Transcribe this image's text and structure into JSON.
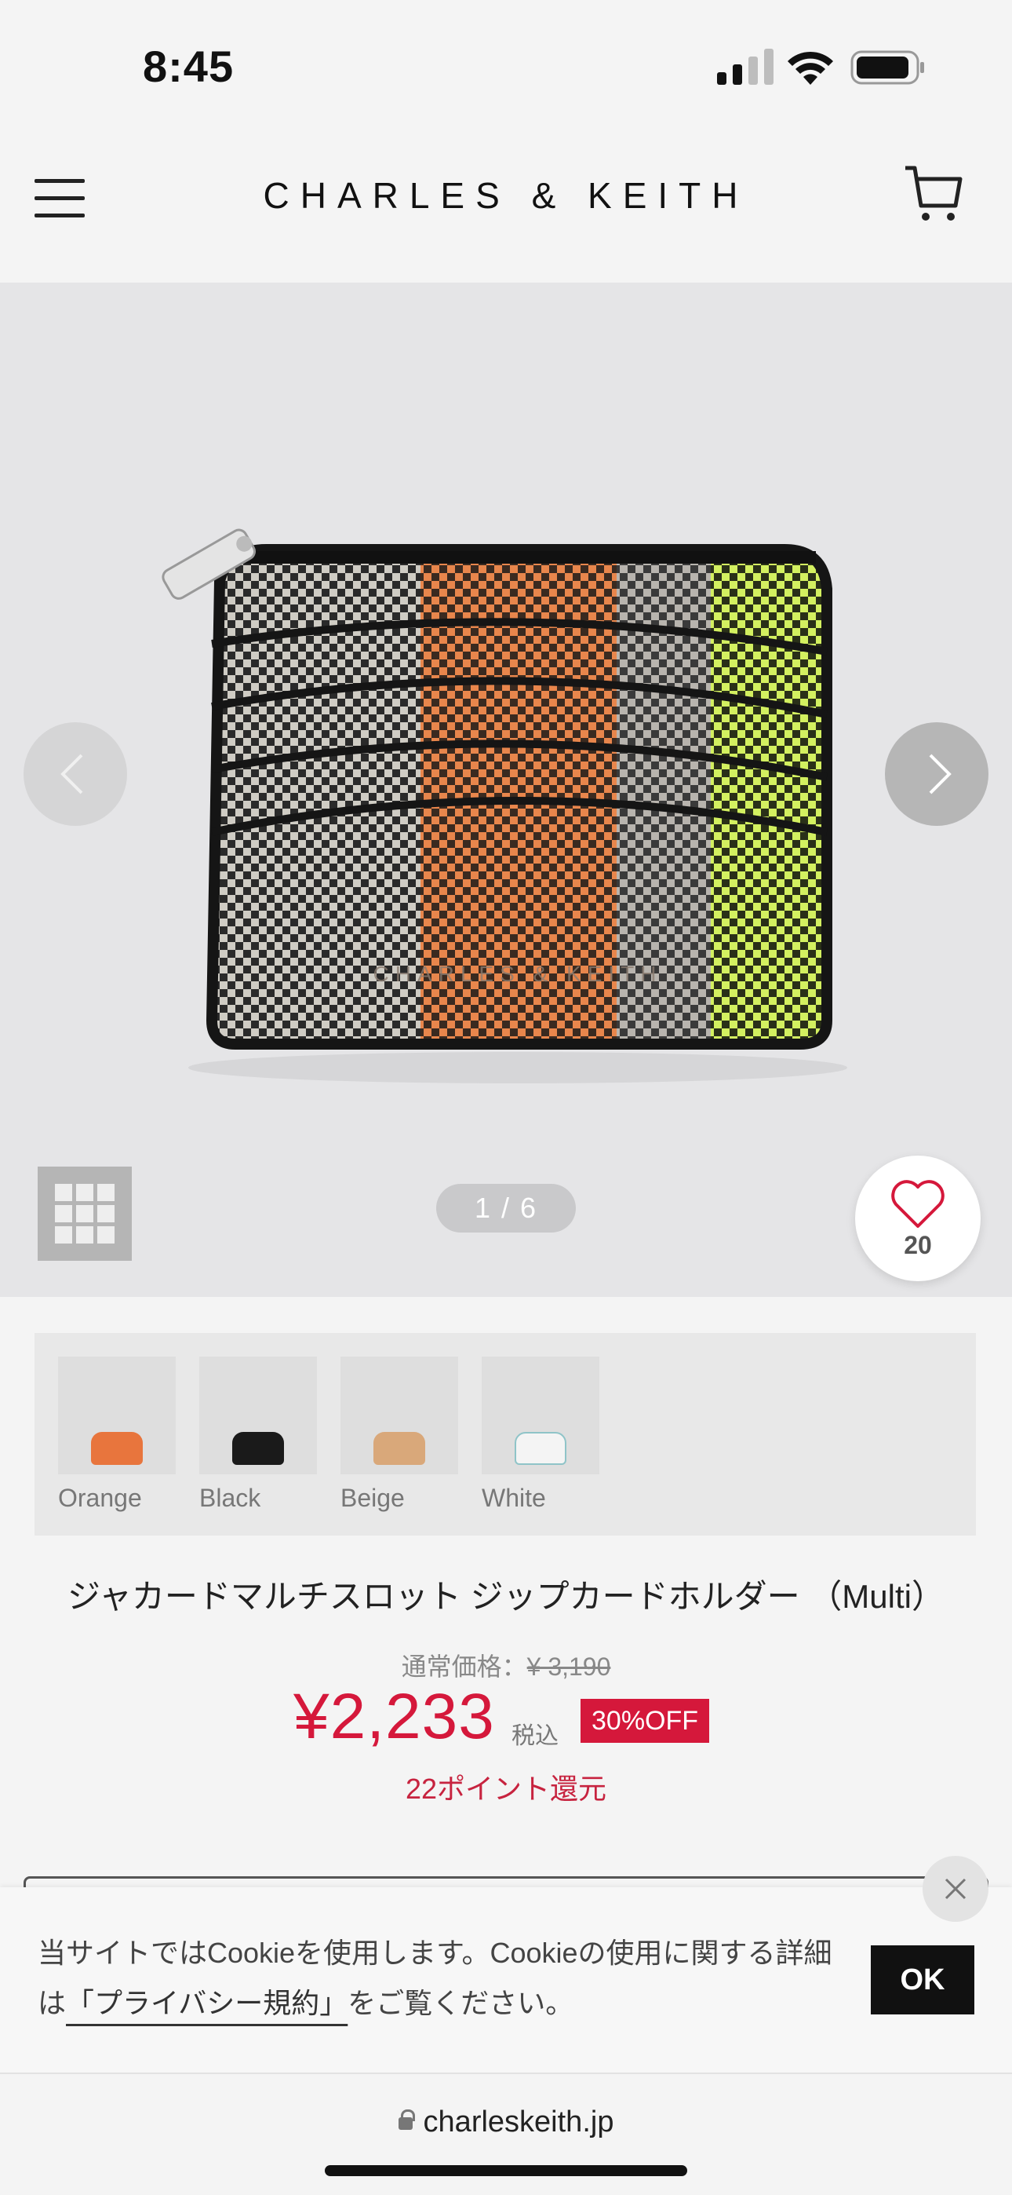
{
  "status_bar": {
    "time": "8:45"
  },
  "header": {
    "brand": "CHARLES & KEITH",
    "menu_icon": "hamburger-menu-icon",
    "cart_icon": "shopping-cart-icon"
  },
  "gallery": {
    "pager": "1 / 6",
    "like_count": "20",
    "prev_icon": "chevron-left-icon",
    "next_icon": "chevron-right-icon",
    "grid_icon": "grid-icon",
    "like_icon": "heart-icon"
  },
  "swatches": [
    {
      "label": "Orange",
      "color": "#e8753d"
    },
    {
      "label": "Black",
      "color": "#1a1a1a"
    },
    {
      "label": "Beige",
      "color": "#d9a87a"
    },
    {
      "label": "White",
      "color": "#f2f2f2"
    }
  ],
  "product": {
    "title": "ジャカードマルチスロット ジップカードホルダー （Multi）",
    "regular_price_label": "通常価格：",
    "regular_price": "¥ 3,190",
    "sale_price": "¥2,233",
    "tax_label": "税込",
    "discount": "30%OFF",
    "points": "22ポイント還元"
  },
  "cookie": {
    "text_before": "当サイトではCookieを使用します。Cookieの使用に関する詳細は",
    "link_text": "「プライバシー規約」",
    "text_after": "をご覧ください。",
    "ok_label": "OK",
    "close_icon": "close-icon"
  },
  "browser": {
    "url": "charleskeith.jp"
  },
  "colors": {
    "accent_red": "#d5183b",
    "points_red": "#c7233f"
  }
}
